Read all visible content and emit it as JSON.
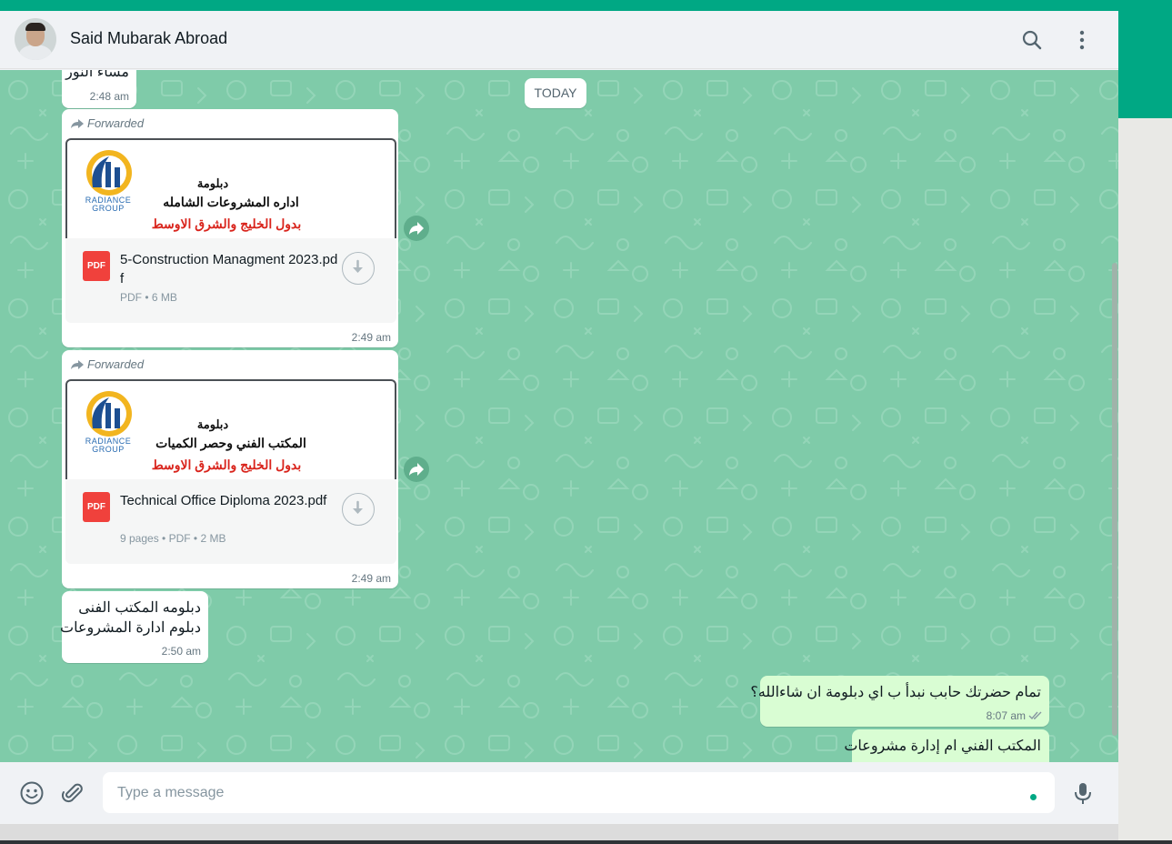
{
  "header": {
    "contact_name": "Said Mubarak Abroad",
    "icons": [
      "search-icon",
      "menu-icon"
    ]
  },
  "chat": {
    "date_chip": "TODAY",
    "messages": [
      {
        "partial_text": "مساء النور",
        "time": "2:48 am"
      },
      {
        "forwarded_label": "Forwarded",
        "thumb_title": "دبلومة",
        "thumb_subtitle": "اداره المشروعات الشامله",
        "thumb_region": "بدول الخليج والشرق الاوسط",
        "brand": "RADIANCE GROUP",
        "file_icon_label": "PDF",
        "file_name": "5-Construction Managment 2023.pdf",
        "file_meta": "PDF • 6 MB",
        "time": "2:49 am"
      },
      {
        "forwarded_label": "Forwarded",
        "thumb_title": "دبلومة",
        "thumb_subtitle": "المكتب الفني وحصر الكميات",
        "thumb_region": "بدول الخليج والشرق الاوسط",
        "brand": "RADIANCE GROUP",
        "file_icon_label": "PDF",
        "file_name": "Technical Office Diploma 2023.pdf",
        "file_meta": "9 pages • PDF • 2 MB",
        "time": "2:49 am"
      },
      {
        "line1": "دبلومه المكتب الفنى",
        "line2": "دبلوم ادارة المشروعات",
        "time": "2:50 am"
      },
      {
        "text": "تمام حضرتك حابب نبدأ ب اي دبلومة ان شاءالله؟",
        "time": "8:07 am",
        "status": "read"
      },
      {
        "text": "المكتب الفني ام إدارة مشروعات"
      }
    ]
  },
  "footer": {
    "input_placeholder": "Type a message",
    "input_value": "",
    "icons": [
      "emoji-icon",
      "attach-icon",
      "mic-icon"
    ]
  },
  "colors": {
    "brand_green": "#00a884",
    "chat_background": "#7fcba9",
    "outgoing_bubble": "#d9fdd3",
    "incoming_bubble": "#ffffff"
  }
}
